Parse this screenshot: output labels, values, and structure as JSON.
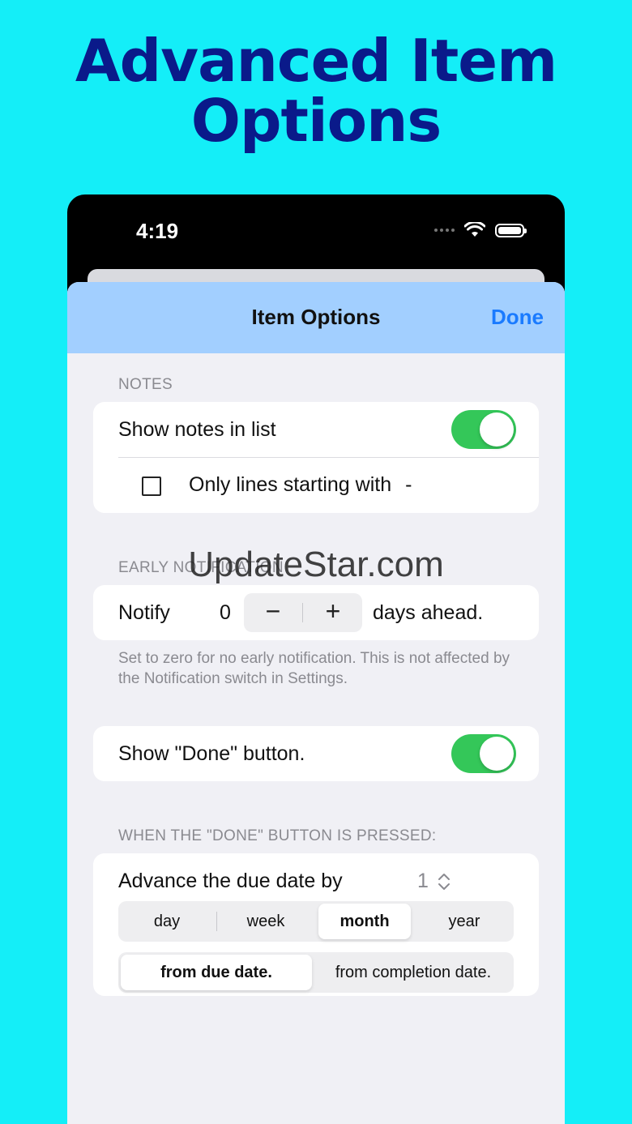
{
  "headline": {
    "line1": "Advanced Item",
    "line2": "Options"
  },
  "status_bar": {
    "time": "4:19",
    "wifi_icon": "wifi-icon",
    "battery_icon": "battery-icon"
  },
  "nav": {
    "title": "Item Options",
    "done_label": "Done"
  },
  "notes": {
    "header": "NOTES",
    "show_notes_label": "Show notes in list",
    "show_notes_on": true,
    "only_lines_label": "Only lines starting with",
    "only_lines_prefix": "-",
    "only_lines_checked": false
  },
  "early_notification": {
    "header": "EARLY NOTIFICATION",
    "notify_label": "Notify",
    "value": "0",
    "minus": "−",
    "plus": "+",
    "suffix": "days ahead.",
    "footer": "Set to zero for no early notification.  This is not affected by the Notification switch in Settings."
  },
  "done_button": {
    "label": "Show \"Done\" button.",
    "on": true
  },
  "when_done": {
    "header": "WHEN THE \"DONE\" BUTTON IS PRESSED:",
    "advance_label": "Advance the due date by",
    "advance_value": "1",
    "units": [
      "day",
      "week",
      "month",
      "year"
    ],
    "selected_unit": "month",
    "from_options": [
      "from due date.",
      "from completion date."
    ],
    "selected_from": "from due date."
  },
  "watermark": "UpdateStar.com",
  "colors": {
    "background": "#14eef8",
    "headline": "#0a1a8a",
    "nav_bar": "#a2cfff",
    "accent": "#1a7bff",
    "toggle_on": "#34c759"
  }
}
